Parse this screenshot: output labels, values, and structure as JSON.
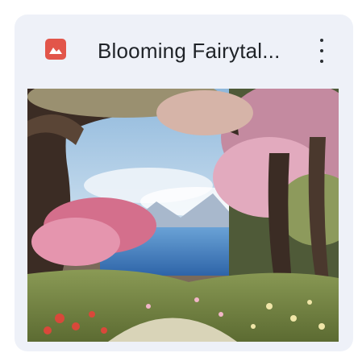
{
  "file": {
    "title": "Blooming Fairytal...",
    "type_icon": "image-file-icon",
    "icon_color": "#e2554a"
  },
  "menu": {
    "icon": "more-vert-icon"
  },
  "thumbnail": {
    "subject": "painted landscape with twisted trees, pink blossoms, blue lake and distant mountains",
    "colors": {
      "sky": "#9cc4e4",
      "lake": "#4a86c6",
      "blossom": "#e7a6be",
      "grass": "#6f8a3f",
      "trunk": "#3b2c24"
    }
  }
}
